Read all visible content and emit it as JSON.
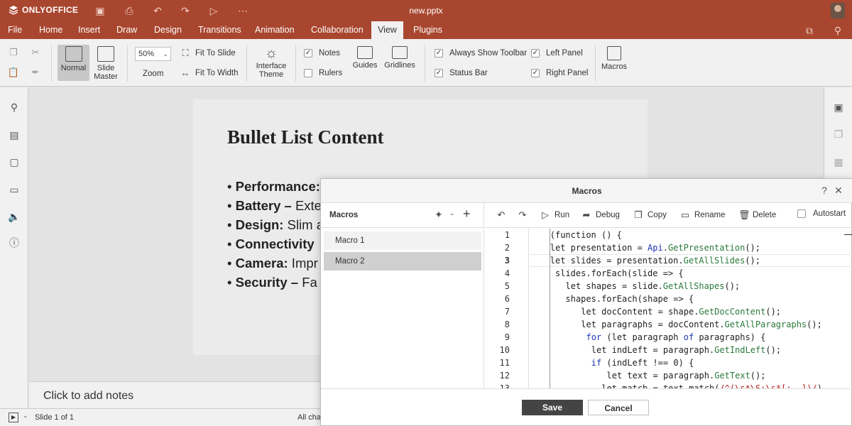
{
  "app": {
    "brand": "ONLYOFFICE",
    "doc_title": "new.pptx"
  },
  "colors": {
    "header": "#a9462f",
    "toolbar": "#f1f1f1",
    "dialog_save": "#444444"
  },
  "menu": {
    "tabs": [
      "File",
      "Home",
      "Insert",
      "Draw",
      "Design",
      "Transitions",
      "Animation",
      "Collaboration",
      "View",
      "Plugins"
    ],
    "active": "View"
  },
  "toolbar": {
    "normal_label": "Normal",
    "slide_master_label": "Slide\nMaster",
    "zoom_value": "50%",
    "zoom_label": "Zoom",
    "fit_to_slide": "Fit To Slide",
    "fit_to_width": "Fit To Width",
    "interface_theme_label": "Interface\nTheme",
    "notes_label": "Notes",
    "rulers_label": "Rulers",
    "guides_label": "Guides",
    "gridlines_label": "Gridlines",
    "always_show_toolbar": "Always Show Toolbar",
    "status_bar": "Status Bar",
    "left_panel": "Left Panel",
    "right_panel": "Right Panel",
    "macros_label": "Macros",
    "checks": {
      "notes": true,
      "rulers": false,
      "always_show_toolbar": true,
      "status_bar": true,
      "left_panel": true,
      "right_panel": true
    }
  },
  "slide": {
    "title": "Bullet List Content",
    "bullets": [
      {
        "bold": "Performance:",
        "rest": ""
      },
      {
        "bold": "Battery –",
        "rest": " Exte"
      },
      {
        "bold": "Design:",
        "rest": " Slim a"
      },
      {
        "bold": "Connectivity",
        "rest": ""
      },
      {
        "bold": "Camera:",
        "rest": " Impr"
      },
      {
        "bold": "Security –",
        "rest": " Fa"
      }
    ]
  },
  "notes": {
    "placeholder": "Click to add notes"
  },
  "status": {
    "slide_counter": "Slide 1 of 1",
    "changes_truncated": "All cha"
  },
  "dialog": {
    "title": "Macros",
    "left_header": "Macros",
    "macros": [
      {
        "name": "Macro 1",
        "selected": false
      },
      {
        "name": "Macro 2",
        "selected": true
      }
    ],
    "editor_buttons": {
      "run": "Run",
      "debug": "Debug",
      "copy": "Copy",
      "rename": "Rename",
      "delete": "Delete",
      "autostart": "Autostart"
    },
    "code_lines": [
      {
        "n": "1",
        "indent": 3,
        "tokens": [
          [
            "p",
            "(function () {"
          ]
        ]
      },
      {
        "n": "2",
        "indent": 3,
        "tokens": [
          [
            "p",
            "let presentation = "
          ],
          [
            "kw",
            "Api"
          ],
          [
            "p",
            "."
          ],
          [
            "fn",
            "GetPresentation"
          ],
          [
            "p",
            "();"
          ]
        ]
      },
      {
        "n": "3",
        "indent": 3,
        "tokens": [
          [
            "p",
            "let slides = presentation."
          ],
          [
            "fn",
            "GetAllSlides"
          ],
          [
            "p",
            "();"
          ]
        ]
      },
      {
        "n": "4",
        "indent": 4,
        "tokens": [
          [
            "p",
            "slides.forEach(slide => {"
          ]
        ]
      },
      {
        "n": "5",
        "indent": 6,
        "tokens": [
          [
            "p",
            "let shapes = slide."
          ],
          [
            "fn",
            "GetAllShapes"
          ],
          [
            "p",
            "();"
          ]
        ]
      },
      {
        "n": "6",
        "indent": 6,
        "tokens": [
          [
            "p",
            "shapes.forEach(shape => {"
          ]
        ]
      },
      {
        "n": "7",
        "indent": 9,
        "tokens": [
          [
            "p",
            "let docContent = shape."
          ],
          [
            "fn",
            "GetDocContent"
          ],
          [
            "p",
            "();"
          ]
        ]
      },
      {
        "n": "8",
        "indent": 9,
        "tokens": [
          [
            "p",
            "let paragraphs = docContent."
          ],
          [
            "fn",
            "GetAllParagraphs"
          ],
          [
            "p",
            "();"
          ]
        ]
      },
      {
        "n": "9",
        "indent": 9,
        "tokens": [
          [
            "kw",
            " for"
          ],
          [
            "p",
            " (let paragraph "
          ],
          [
            "kw",
            "of"
          ],
          [
            "p",
            " paragraphs) {"
          ]
        ]
      },
      {
        "n": "10",
        "indent": 11,
        "tokens": [
          [
            "p",
            "let indLeft = paragraph."
          ],
          [
            "fn",
            "GetIndLeft"
          ],
          [
            "p",
            "();"
          ]
        ]
      },
      {
        "n": "11",
        "indent": 11,
        "tokens": [
          [
            "kw",
            "if"
          ],
          [
            "p",
            " (indLeft !== 0) {"
          ]
        ]
      },
      {
        "n": "12",
        "indent": 14,
        "tokens": [
          [
            "p",
            "let text = paragraph."
          ],
          [
            "fn",
            "GetText"
          ],
          [
            "p",
            "();"
          ]
        ]
      },
      {
        "n": "13",
        "indent": 13,
        "tokens": [
          [
            "p",
            "let match = text.match("
          ],
          [
            "re",
            "/^(\\s*\\S+\\s*[:–-])/"
          ],
          [
            "p",
            ")"
          ]
        ]
      }
    ],
    "save_label": "Save",
    "cancel_label": "Cancel"
  }
}
